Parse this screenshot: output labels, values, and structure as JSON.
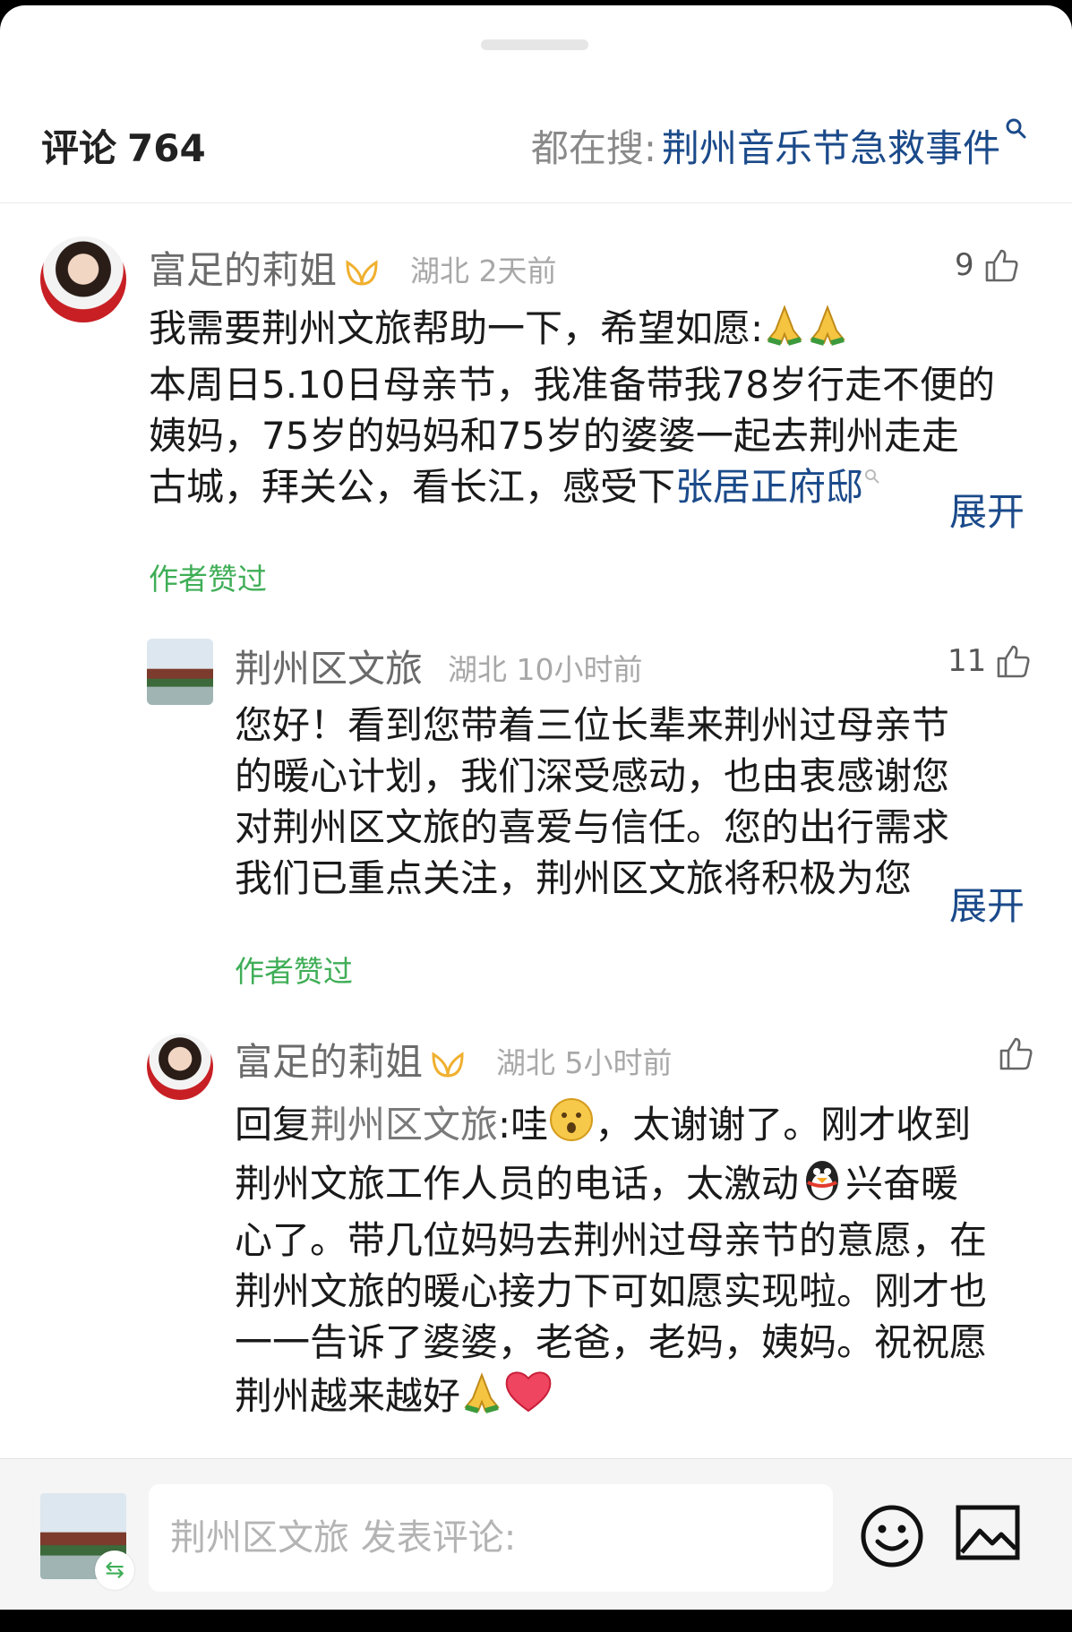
{
  "header": {
    "title": "评论",
    "count": "764",
    "hot_label": "都在搜:",
    "hot_term": "荆州音乐节急救事件"
  },
  "comments": [
    {
      "name": "富足的莉姐",
      "region": "湖北",
      "time": "2天前",
      "likes": "9",
      "lines": [
        "我需要荆州文旅帮助一下，希望如愿:",
        "本周日5.10日母亲节，我准备带我78岁行走不便的",
        "姨妈，75岁的妈妈和75岁的婆婆一起去荆州走走",
        "古城，拜关公，看长江，感受下"
      ],
      "link_text": "张居正府邸",
      "expand": "展开",
      "author_liked": "作者赞过"
    },
    {
      "name": "荆州区文旅",
      "region": "湖北",
      "time": "10小时前",
      "likes": "11",
      "lines": [
        "您好！看到您带着三位长辈来荆州过母亲节",
        "的暖心计划，我们深受感动，也由衷感谢您",
        "对荆州区文旅的喜爱与信任。您的出行需求",
        "我们已重点关注，荆州区文旅将积极为您"
      ],
      "expand": "展开",
      "author_liked": "作者赞过"
    },
    {
      "name": "富足的莉姐",
      "region": "湖北",
      "time": "5小时前",
      "reply_prefix": "回复",
      "reply_to": "荆州区文旅",
      "line1_after": ":哇",
      "line1_end": "，太谢谢了。刚才收到",
      "line2_a": "荆州文旅工作人员的电话，太激动",
      "line2_b": "兴奋暖",
      "lines": [
        "心了。带几位妈妈去荆州过母亲节的意愿，在",
        "荆州文旅的暖心接力下可如愿实现啦。刚才也",
        "一一告诉了婆婆，老爸，老妈，姨妈。祝祝愿"
      ],
      "last_line": "荆州越来越好"
    }
  ],
  "composer": {
    "placeholder": "荆州区文旅 发表评论:"
  },
  "icons": [
    "search-icon",
    "vip-badge-icon",
    "thumb-up-icon",
    "pray-emoji",
    "surprised-emoji",
    "penguin-emoji",
    "heart-emoji",
    "swap-icon",
    "emoji-icon",
    "image-icon"
  ],
  "colors": {
    "link": "#1b4a8a",
    "liked": "#3fae57",
    "muted": "#a8a8a8"
  }
}
